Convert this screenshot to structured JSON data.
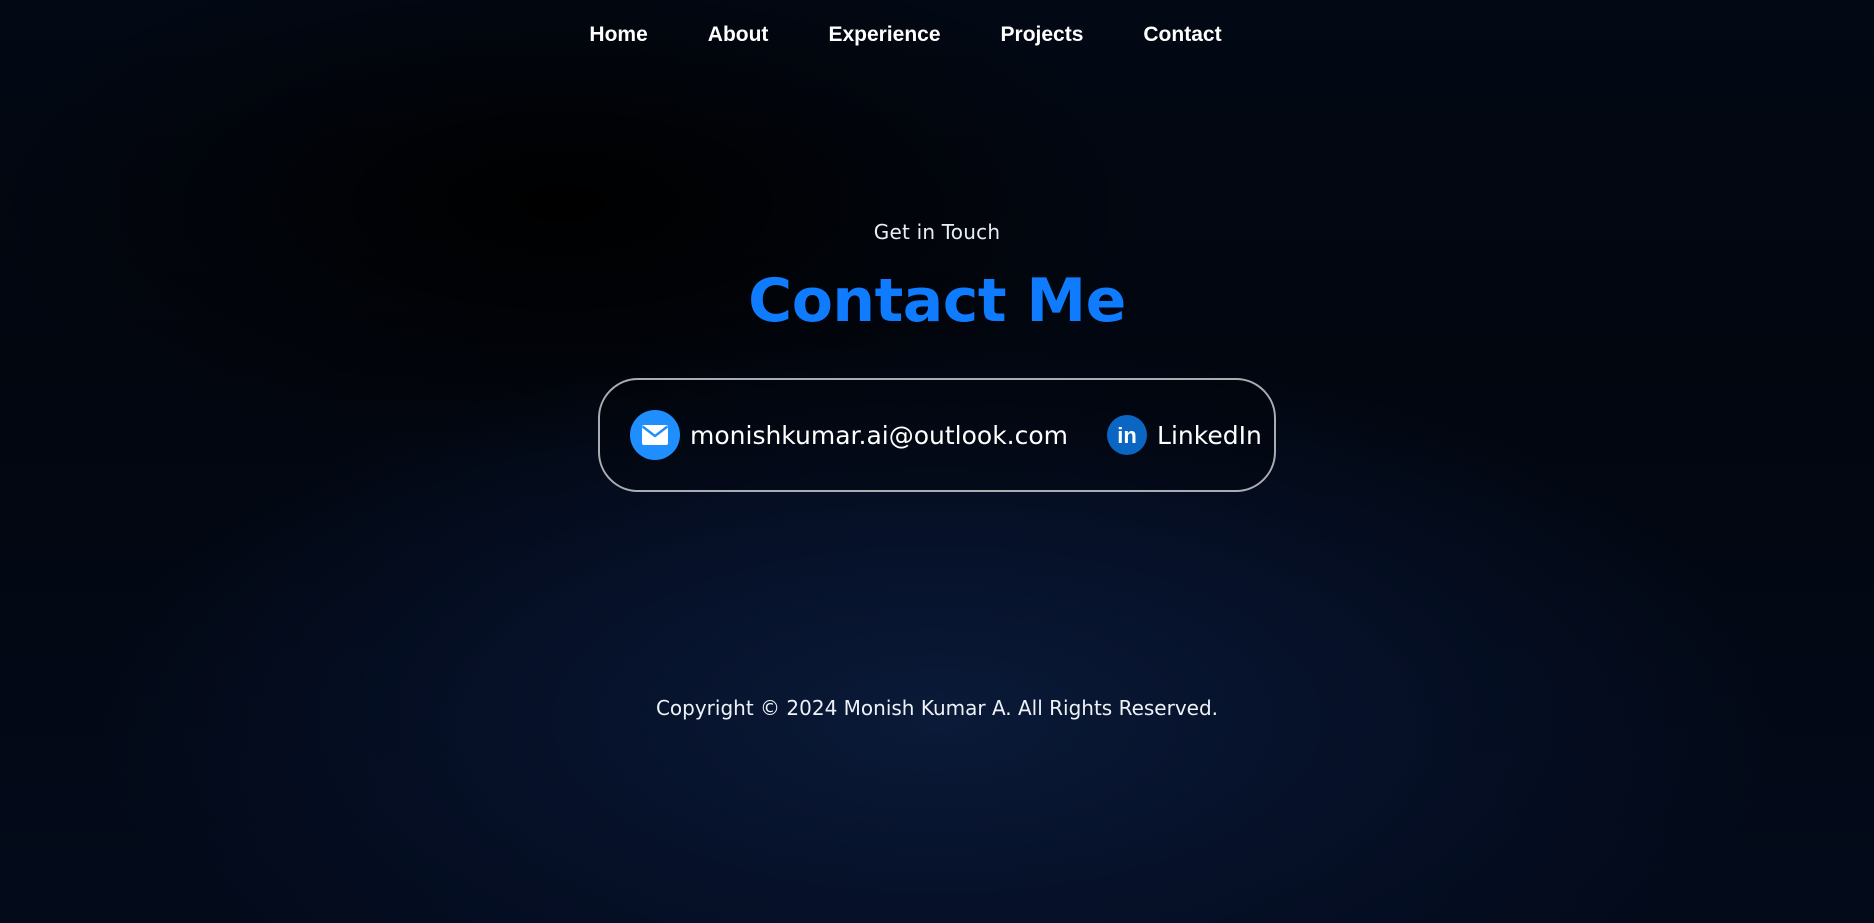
{
  "nav": {
    "items": [
      {
        "label": "Home"
      },
      {
        "label": "About"
      },
      {
        "label": "Experience"
      },
      {
        "label": "Projects"
      },
      {
        "label": "Contact"
      }
    ]
  },
  "contact": {
    "eyebrow": "Get in Touch",
    "title": "Contact Me",
    "email": {
      "icon": "envelope-icon",
      "text": "monishkumar.ai@outlook.com"
    },
    "linkedin": {
      "icon": "linkedin-icon",
      "glyph": "in",
      "text": "LinkedIn"
    }
  },
  "footer": {
    "copyright": "Copyright © 2024 Monish Kumar A. All Rights Reserved."
  },
  "colors": {
    "accent": "#0f7cff",
    "email_icon_bg": "#1f8fff",
    "linkedin_icon_bg": "#0a66c2",
    "card_border": "#a9adb3",
    "background": "#020814"
  }
}
